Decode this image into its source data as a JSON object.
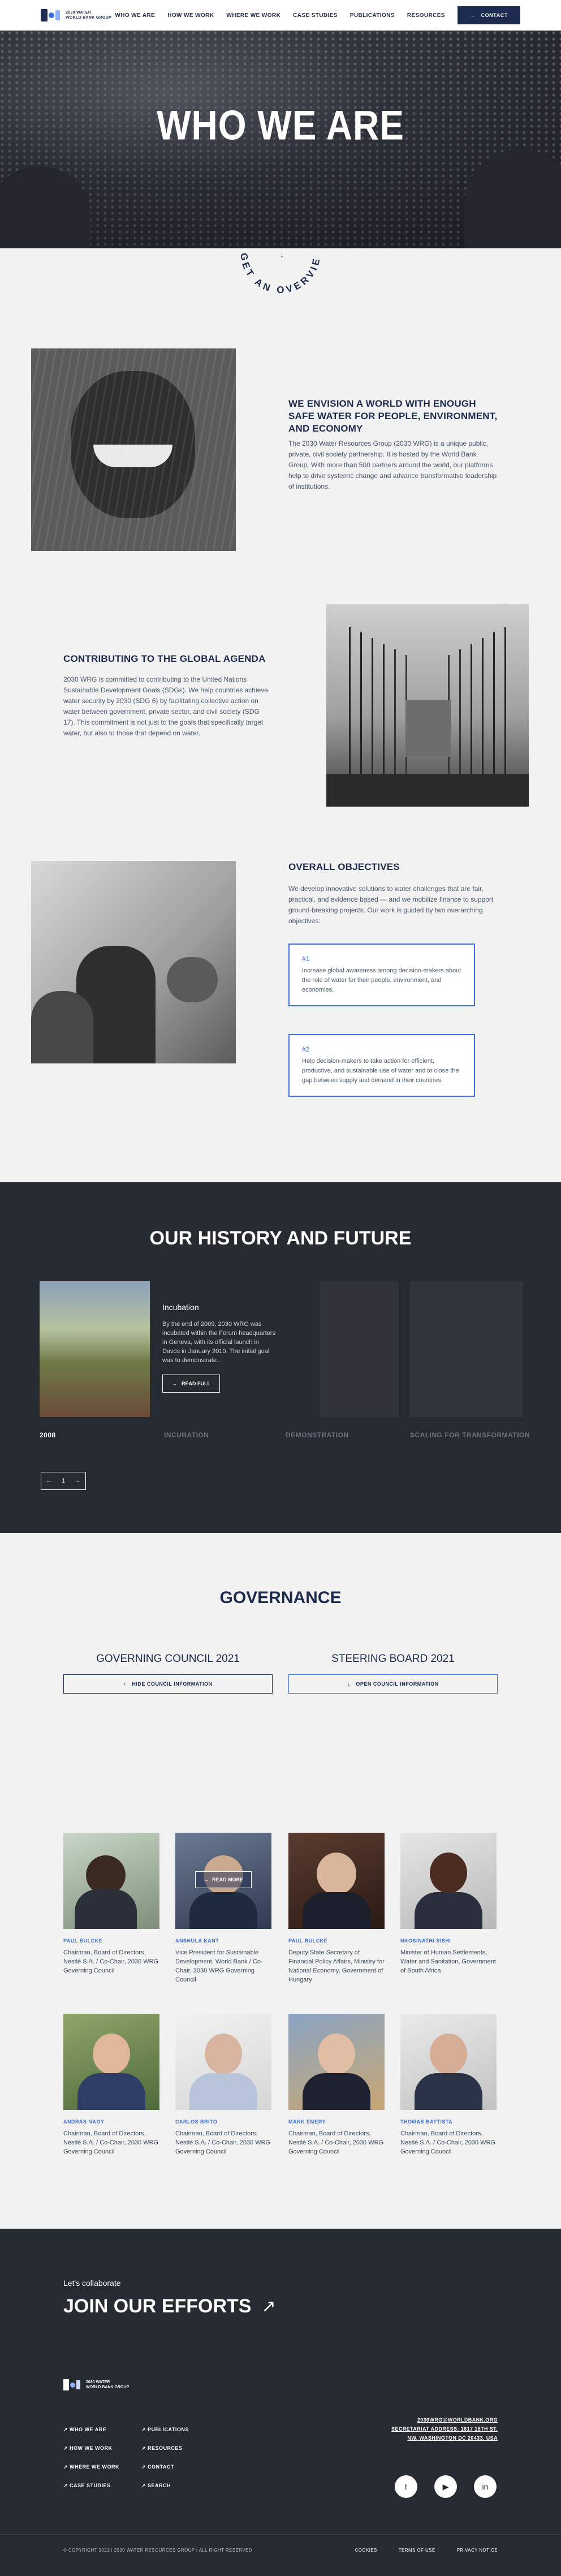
{
  "header": {
    "logo_line1": "2030 WATER",
    "logo_line2": "WORLD BANK GROUP",
    "nav": [
      "WHO WE ARE",
      "HOW WE WORK",
      "WHERE WE WORK",
      "CASE STUDIES",
      "PUBLICATIONS",
      "RESOURCES"
    ],
    "contact_label": "CONTACT",
    "contact_icon": "arrow-right-icon"
  },
  "hero": {
    "title": "WHO WE ARE"
  },
  "overview": {
    "label": "GET AN OVERVIEW",
    "arrow_icon": "arrow-down-icon"
  },
  "vision": {
    "heading": "WE ENVISION A WORLD WITH ENOUGH SAFE WATER FOR PEOPLE, ENVIRONMENT, AND ECONOMY",
    "text": "The 2030 Water Resources Group (2030 WRG) is a unique public, private, civil society partnership. It is hosted by the World Bank Group. With more than 500 partners around the world, our platforms help to drive systemic change and advance transformative leadership of institutions."
  },
  "agenda": {
    "heading": "CONTRIBUTING TO THE GLOBAL AGENDA",
    "text": "2030 WRG is committed to contributing to the United Nations Sustainable Development Goals (SDGs). We help countries achieve water security by 2030 (SDG 6) by facilitating collective action on water between government, private sector, and civil society (SDG 17). This commitment is not just to the goals that specifically target water, but also to those that depend on water."
  },
  "objectives": {
    "heading": "OVERALL OBJECTIVES",
    "text": "We develop innovative solutions to water challenges that are fair, practical, and evidence based — and we mobilize finance to support ground-breaking projects. Our work is guided by two overarching objectives:",
    "cards": [
      {
        "num": "#1",
        "text": "Increase global awareness among decision-makers about the role of water for their people, environment, and economies."
      },
      {
        "num": "#2",
        "text": "Help decision-makers to take action for efficient, productive, and sustainable use of water and to close the gap between supply and demand in their countries."
      }
    ]
  },
  "history": {
    "title": "OUR HISTORY AND FUTURE",
    "slide_heading": "Incubation",
    "slide_text": "By the end of 2009, 2030 WRG was incubated within the Forum headquarters in Geneva, with its official launch in Davos in January 2010. The initial goal was to demonstrate...",
    "read_full": "READ FULL",
    "years": [
      "2008",
      "INCUBATION",
      "DEMONSTRATION",
      "SCALING FOR TRANSFORMATION"
    ],
    "page": "1"
  },
  "governance": {
    "title": "GOVERNANCE",
    "council_title": "GOVERNING COUNCIL 2021",
    "council_btn": "HIDE COUNCIL INFORMATION",
    "board_title": "STEERING BOARD 2021",
    "board_btn": "OPEN COUNCIL INFORMATION",
    "read_more": "READ MORE",
    "members": [
      {
        "name": "PAUL BULCKE",
        "role": "Chairman, Board of Directors, Nestlé S.A. / Co-Chair, 2030 WRG Governing Council"
      },
      {
        "name": "ANSHULA KANT",
        "role": "Vice President for Sustainable Development, World Bank / Co-Chair, 2030 WRG Governing Council"
      },
      {
        "name": "PAUL BULCKE",
        "role": "Deputy State Secretary of Financial Policy Affairs, Ministry for National Economy, Government of Hungary"
      },
      {
        "name": "NKOSINATHI SISHI",
        "role": "Minister of Human Settlements, Water and Sanitation, Government of South Africa"
      },
      {
        "name": "ANDRÁS NAGY",
        "role": "Chairman, Board of Directors, Nestlé S.A. / Co-Chair, 2030 WRG Governing Council"
      },
      {
        "name": "CARLOS BRITO",
        "role": "Chairman, Board of Directors, Nestlé S.A. / Co-Chair, 2030 WRG Governing Council"
      },
      {
        "name": "MARK EMERY",
        "role": "Chairman, Board of Directors, Nestlé S.A. / Co-Chair, 2030 WRG Governing Council"
      },
      {
        "name": "THOMAS BATTISTA",
        "role": "Chairman, Board of Directors, Nestlé S.A. / Co-Chair, 2030 WRG Governing Council"
      }
    ]
  },
  "footer": {
    "collab": "Let's collaborate",
    "join": "JOIN OUR EFFORTS",
    "links_col1": [
      "WHO WE ARE",
      "HOW WE WORK",
      "WHERE WE WORK",
      "CASE STUDIES"
    ],
    "links_col2": [
      "PUBLICATIONS",
      "RESOURCES",
      "CONTACT",
      "SEARCH"
    ],
    "email": "2030WRG@WORLDBANK.ORG",
    "address_line1": "SECRETARIAT ADDRESS: 1817 18TH ST.",
    "address_line2": "NW, WASHINGTON DC 20433, USA",
    "copyright": "© COPYRIGHT 2021 | 2030 WATER RESOURCES GROUP | ALL RIGHT RESERVED",
    "legal": [
      "COOKIES",
      "TERMS OF USE",
      "PRIVACY NOTICE"
    ],
    "social_icons": [
      "twitter-icon",
      "youtube-icon",
      "linkedin-icon"
    ]
  }
}
